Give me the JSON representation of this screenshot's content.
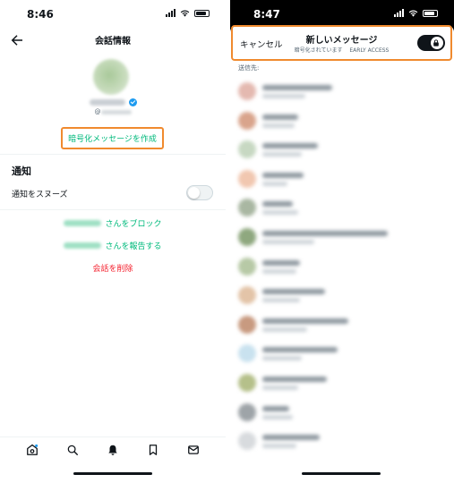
{
  "left_screen": {
    "status_time": "8:46",
    "header": {
      "title": "会話情報"
    },
    "profile": {
      "handle_prefix": "@"
    },
    "encrypt_button_label": "暗号化メッセージを作成",
    "notifications": {
      "section_title": "通知",
      "snooze_label": "通知をスヌーズ",
      "snooze_enabled": false
    },
    "actions": {
      "block_suffix": "さんをブロック",
      "report_suffix": "さんを報告する",
      "delete_label": "会話を削除"
    },
    "tab_bar": [
      "home-icon",
      "search-icon",
      "bell-icon",
      "bookmark-icon",
      "mail-icon"
    ]
  },
  "right_screen": {
    "status_time": "8:47",
    "sheet": {
      "cancel_label": "キャンセル",
      "title": "新しいメッセージ",
      "subtitle": "暗号化されています",
      "badge": "EARLY ACCESS",
      "encryption_enabled": true,
      "to_label": "送信先:"
    },
    "contacts": [
      {
        "avatar_color": "#e4b9b0"
      },
      {
        "avatar_color": "#d9a48c"
      },
      {
        "avatar_color": "#c7d8c2"
      },
      {
        "avatar_color": "#f1c7b0"
      },
      {
        "avatar_color": "#a9b7a2"
      },
      {
        "avatar_color": "#8fa87f"
      },
      {
        "avatar_color": "#b7c9a6"
      },
      {
        "avatar_color": "#e3c4a8"
      },
      {
        "avatar_color": "#c89a80"
      },
      {
        "avatar_color": "#c9e2ef"
      },
      {
        "avatar_color": "#b5c08a"
      },
      {
        "avatar_color": "#9ea4a8"
      },
      {
        "avatar_color": "#d8dbde"
      }
    ]
  },
  "colors": {
    "accent_green": "#00ba7c",
    "danger_red": "#f4212e",
    "highlight_orange": "#f08a2e",
    "verified_blue": "#1d9bf0"
  }
}
